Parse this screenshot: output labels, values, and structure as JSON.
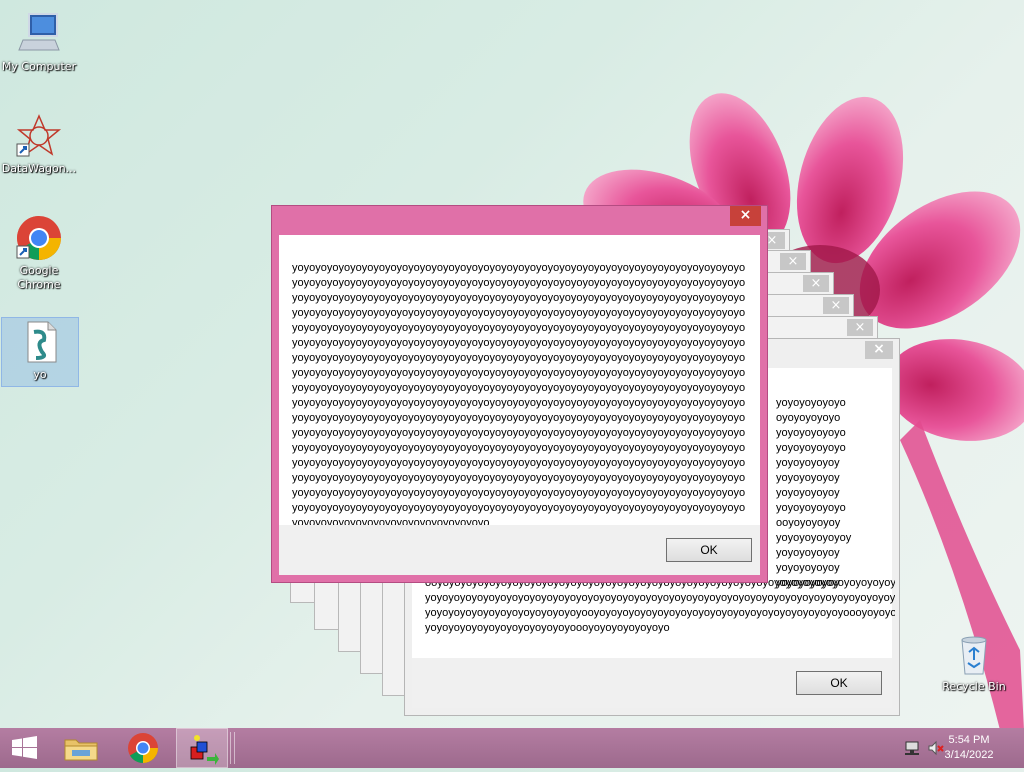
{
  "desktop": {
    "icons": [
      {
        "label": "My Computer",
        "icon": "computer-icon"
      },
      {
        "label": "DataWagon...",
        "icon": "datawagon-icon"
      },
      {
        "label": "Google Chrome",
        "icon": "chrome-icon"
      },
      {
        "label": "yo",
        "icon": "script-file-icon"
      },
      {
        "label": "Recycle Bin",
        "icon": "recycle-bin-icon"
      }
    ]
  },
  "dialogs": {
    "front": {
      "message": "yoyoyoyoyoyoyoyoyoyoyoyoyoyoyoyoyoyoyoyoyoyoyoyoyoyoyoyoyoyoyoyoyoyoyoyoyoyoyoyoyoyoyoyoyoyoyoyoyoyoyoyoyoyoyoyoyoyoyoyoyoyoyoyoyoyoyoyoyoyoyoyoyoyoyoyoyoyoyoyoyoyoyoyoyoyoyoyoyoyoyoyoyoyoyoyoyoyoyoyoyoyoyoyoyoyoyoyoyoyoyoyoyoyoyoyoyoyoyoyoyoyoyoyoyoyoyoyoyoyoyoyoyoyoyoyoyoyoyoyoyoyoyoyoyoyoyoyoyoyoyoyoyoyoyoyoyoyoyoyoyoyoyoyoyoyoyoyoyoyoyoyoyoyoyoyoyoyoyoyoyoyoyoyoyoyoyoyoyoyoyoyoyoyoyoyoyoyoyoyoyoyoyoyoyoyoyoyoyoyoyoyoyoyoyoyoyoyoyoyoyoyoyoyoyoyoyoyoyoyoyoyoyoyoyoyoyoyoyoyoyoyoyoyoyoyoyoyoyoyoyoyoyoyoyoyoyoyoyoyoyoyoyoyoyoyoyoyoyoyoyoyoyoyoyoyoyoyoyoyoyoyoyoyoyoyoyoyoyoyoyoyoyoyoyoyoyoyoyoyoyoyoyoyoyoyoyoyoyoyoyoyoyoyoyoyoyoyoyoyoyoyoyoyoyoyoyoyoyoyoyoyoyoyoyoyoyoyoyoyoyoyoyoyoyoyoyoyoyoyoyoyoyoyoyoyoyoyoyoyoyoyoyoyoyoyoyoyoyoyoyoyoyoyoyoyoyoyoyoyoyoyoyoyoyoyoyoyoyoyoyoyoyoyoyoyoyoyoyoyoyoyoyoyoyoyoyoyoyoyoyoyoyoyoyoyoyoyoyoyoyoyoyoyoyoyoyoyoyoyoyoyoyoyoyoyoyoyoyoyoyoyoyoyoyoyoyoyoyoyoyoyoyoyoyoyoyoyoyoyoyoyoyoyoyoyoyoyoyoyoyoyoyoyoyoyoyoyoyoyoyoyoyoyoyoyoyoyoyoyoyoyoyoyoyoyoyoyoyoyoyoyoyoyoyoyoyoyoyoyoyoyoyoyoyoyoyoyoyoyoyoyoyoyoyoyoyoyoyoyoyoyoyoyoyoyoyoyoyoyoyoyoyoyoyoyoyoyoyoyoyoyoyoyoyoyoyoyoyoyoyoyoyoyoyoyoyoyoyoyoyoyoyoyoyoyoyoyoyoyoyoyoyoyoyoyoyoyoyoyoyoyoyoyoyoyoyoyoyoyoyoyoyoyoyoyoyoyoyoyoyoyoyoyoyoyoyoyoyoyoyoyoyoyoyoyoyoyoyoyoyoyoyoyoyoyoyoyoyoyoyoyoyoyoyoyoyoyoyoyoyoyoyoyoyoyoyoyoyoyoyoyoyoyoyoyoyoyoyoyoyoyoyoyoyoyoyoyoyoyo",
      "ok_label": "OK"
    },
    "back": {
      "visible_lines": [
        "yoyoyoyoyoyo",
        "oyoyoyoyoyo",
        "yoyoyoyoyoyo",
        "yoyoyoyoyoyo",
        "yoyoyoyoyoy",
        "yoyoyoyoyoy",
        "yoyoyoyoyoy",
        "yoyoyoyoyoyo",
        "ooyoyoyoyoy",
        "yoyoyoyoyoyoy",
        "yoyoyoyoyoy",
        "yoyoyoyoyoy",
        "yoyoyoyoyoy"
      ],
      "bottom_lines": [
        "ooyoyoyoyoyoyoyoyoyoyoyoyoyoyoyoyoyoyoyoyoyoyoyoyoyoyoyoyoyoyoyoyoyoyoyoyoyoyoyoyoyoyoyoyoyoyooyo",
        "yoyoyoyoyoyoyoyoyoyoyoyoyoyoyoyoyoyoyoyoyoyoyoyoyoyoyoyoyoyoyoyoyoyoyoyoyoyoyoyoyoyoyoyoyoyoyoyoyoy",
        "yoyoyoyoyoyoyoyoyoyoyoyoyoyooyoyoyoyoyoyoyoyoyoyoyoyoyoyoyoyoyoyoyoyoyoyoooyoyoyoyoyoyoyoyoyoyoyoyo",
        "yoyoyoyoyoyoyoyoyoyoyoyoyoooyoyoyoyoyoyoyo"
      ],
      "ok_label": "OK"
    }
  },
  "taskbar": {
    "pinned": [
      {
        "name": "start-button",
        "icon": "windows-logo-icon"
      },
      {
        "name": "file-explorer-button",
        "icon": "folder-icon"
      },
      {
        "name": "chrome-taskbar-button",
        "icon": "chrome-icon"
      },
      {
        "name": "script-host-button",
        "icon": "script-host-icon"
      }
    ],
    "tray": {
      "time": "5:54 PM",
      "date": "3/14/2022"
    }
  },
  "colors": {
    "accent_pink": "#e070a8",
    "taskbar": "#a87096",
    "close_red": "#c7413a"
  }
}
